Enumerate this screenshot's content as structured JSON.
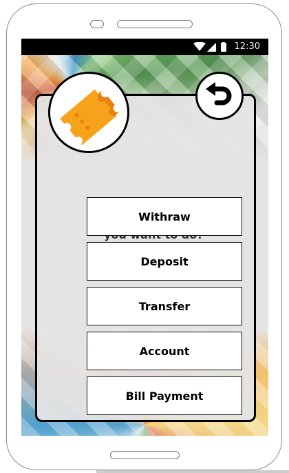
{
  "status_bar": {
    "time": "12:30",
    "icons": [
      "wifi-icon",
      "signal-icon",
      "battery-icon"
    ]
  },
  "header": {
    "app_icon": "ticket-icon",
    "back_icon": "undo-arrow-icon",
    "accent_color": "#f7a21b"
  },
  "main": {
    "question": "What interaction do you want to do?",
    "options": [
      {
        "label": "Withraw"
      },
      {
        "label": "Deposit"
      },
      {
        "label": "Transfer"
      },
      {
        "label": "Account"
      },
      {
        "label": "Bill Payment"
      }
    ]
  }
}
